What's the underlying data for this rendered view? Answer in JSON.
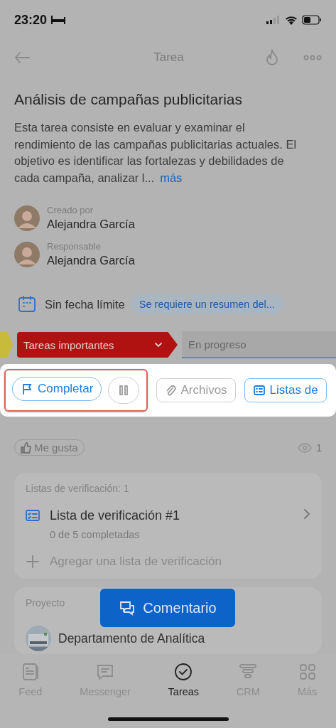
{
  "status_bar": {
    "time": "23:20"
  },
  "header": {
    "title": "Tarea"
  },
  "task": {
    "title": "Análisis de campañas publicitarias",
    "description": "Esta tarea consiste en evaluar y examinar el rendimiento de las campañas publicitarias actuales. El objetivo es identificar las fortalezas y debilidades de cada campaña, analizar l...",
    "more_link": "más"
  },
  "people": [
    {
      "label": "Creado por",
      "name": "Alejandra García"
    },
    {
      "label": "Responsable",
      "name": "Alejandra García"
    }
  ],
  "deadline": {
    "text": "Sin fecha límite",
    "tag": "Se requiere un resumen del..."
  },
  "stages": [
    {
      "kind": "arrow",
      "color": "#c8bb3c"
    },
    {
      "kind": "dropdown",
      "label": "Tareas importantes",
      "color": "#b01212"
    },
    {
      "kind": "field",
      "label": "En progreso"
    }
  ],
  "highlighted_actions": [
    {
      "kind": "complete",
      "label": "Completar"
    },
    {
      "kind": "pause"
    }
  ],
  "actions": [
    {
      "kind": "files",
      "label": "Archivos"
    },
    {
      "kind": "checklists",
      "label": "Listas de"
    }
  ],
  "reactions": {
    "like": "Me gusta",
    "views": "1"
  },
  "checklists": {
    "heading": "Listas de verificación: 1",
    "items": [
      {
        "title": "Lista de verificación #1",
        "progress": "0 de 5 completadas"
      }
    ],
    "add": "Agregar una lista de verificación"
  },
  "comment_button": "Comentario",
  "project": {
    "heading": "Proyecto",
    "name": "Departamento de Analítica"
  },
  "tab_bar": [
    {
      "label": "Feed",
      "selected": false
    },
    {
      "label": "Messenger",
      "selected": false
    },
    {
      "label": "Tareas",
      "selected": true
    },
    {
      "label": "CRM",
      "selected": false
    },
    {
      "label": "Más",
      "selected": false
    }
  ]
}
